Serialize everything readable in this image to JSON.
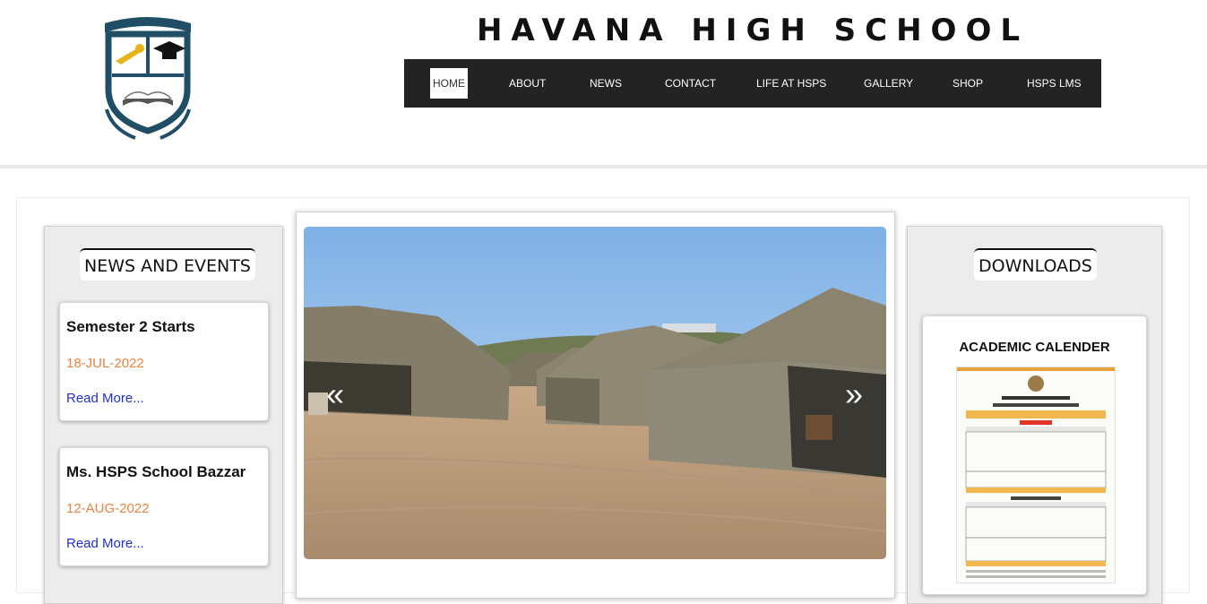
{
  "header": {
    "site_title": "HAVANA HIGH SCHOOL",
    "logo": {
      "motto": "HAVANA HIGH SCHOOL",
      "banner_text": "HAVANA HIGH SCHOOL"
    }
  },
  "nav": {
    "items": [
      {
        "label": "HOME",
        "active": true
      },
      {
        "label": "ABOUT"
      },
      {
        "label": "NEWS"
      },
      {
        "label": "CONTACT"
      },
      {
        "label": "LIFE AT HSPS"
      },
      {
        "label": "GALLERY"
      },
      {
        "label": "SHOP"
      },
      {
        "label": "HSPS LMS"
      }
    ]
  },
  "news": {
    "heading": "NEWS AND EVENTS",
    "items": [
      {
        "title": "Semester 2 Starts",
        "date": "18-JUL-2022",
        "link": "Read More..."
      },
      {
        "title": "Ms. HSPS School Bazzar",
        "date": "12-AUG-2022",
        "link": "Read More..."
      }
    ]
  },
  "slider": {
    "prev_icon": "chevron-double-left-icon",
    "next_icon": "chevron-double-right-icon"
  },
  "downloads": {
    "heading": "DOWNLOADS",
    "items": [
      {
        "title": "ACADEMIC CALENDER"
      }
    ]
  },
  "colors": {
    "nav_bg": "#232323",
    "date_orange": "#e8843f",
    "link_blue": "#1f2fd6",
    "logo_blue": "#1f4e66"
  }
}
